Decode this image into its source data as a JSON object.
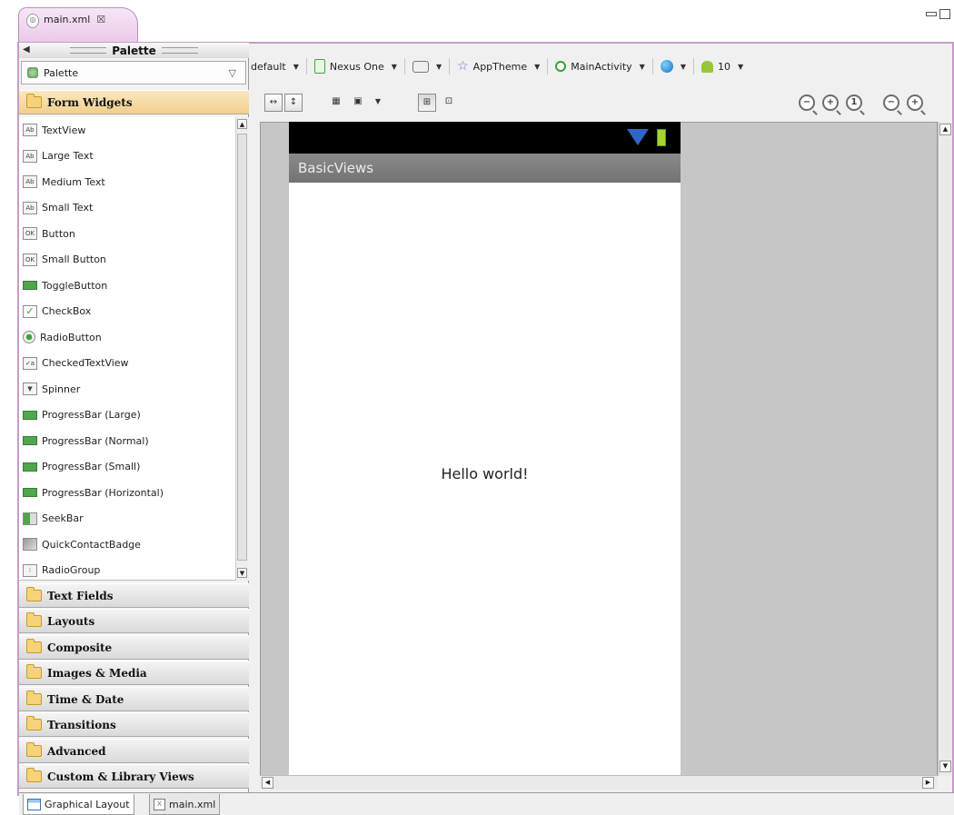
{
  "editor": {
    "tab_label": "main.xml",
    "tab_close": "☒"
  },
  "palette": {
    "title": "Palette",
    "selector_value": "Palette",
    "open_category": "Form Widgets",
    "widgets": [
      {
        "label": "TextView",
        "icon": "Ab"
      },
      {
        "label": "Large Text",
        "icon": "Ab"
      },
      {
        "label": "Medium Text",
        "icon": "Ab"
      },
      {
        "label": "Small Text",
        "icon": "Ab"
      },
      {
        "label": "Button",
        "icon": "OK"
      },
      {
        "label": "Small Button",
        "icon": "OK"
      },
      {
        "label": "ToggleButton",
        "icon": "toggle-icon"
      },
      {
        "label": "CheckBox",
        "icon": "check-icon"
      },
      {
        "label": "RadioButton",
        "icon": "radio-icon"
      },
      {
        "label": "CheckedTextView",
        "icon": "✓a"
      },
      {
        "label": "Spinner",
        "icon": "spinner-icon"
      },
      {
        "label": "ProgressBar (Large)",
        "icon": "progress-icon"
      },
      {
        "label": "ProgressBar (Normal)",
        "icon": "progress-icon"
      },
      {
        "label": "ProgressBar (Small)",
        "icon": "progress-icon"
      },
      {
        "label": "ProgressBar (Horizontal)",
        "icon": "progress-icon"
      },
      {
        "label": "SeekBar",
        "icon": "seekbar-icon"
      },
      {
        "label": "QuickContactBadge",
        "icon": "badge-icon"
      },
      {
        "label": "RadioGroup",
        "icon": "radiogroup-icon"
      }
    ],
    "categories": [
      "Text Fields",
      "Layouts",
      "Composite",
      "Images & Media",
      "Time & Date",
      "Transitions",
      "Advanced",
      "Custom & Library Views"
    ]
  },
  "toolbar": {
    "config": "default",
    "device": "Nexus One",
    "theme": "AppTheme",
    "activity": "MainActivity",
    "api_level": "10"
  },
  "preview": {
    "action_bar_title": "BasicViews",
    "hello_text": "Hello world!"
  },
  "bottom_tabs": {
    "graphical": "Graphical Layout",
    "xml": "main.xml"
  },
  "colors": {
    "editor_frame": "#c99ac8",
    "canvas_bg": "#c6c6c6",
    "status_bar": "#000000",
    "action_bar": "#7d7d7d"
  }
}
